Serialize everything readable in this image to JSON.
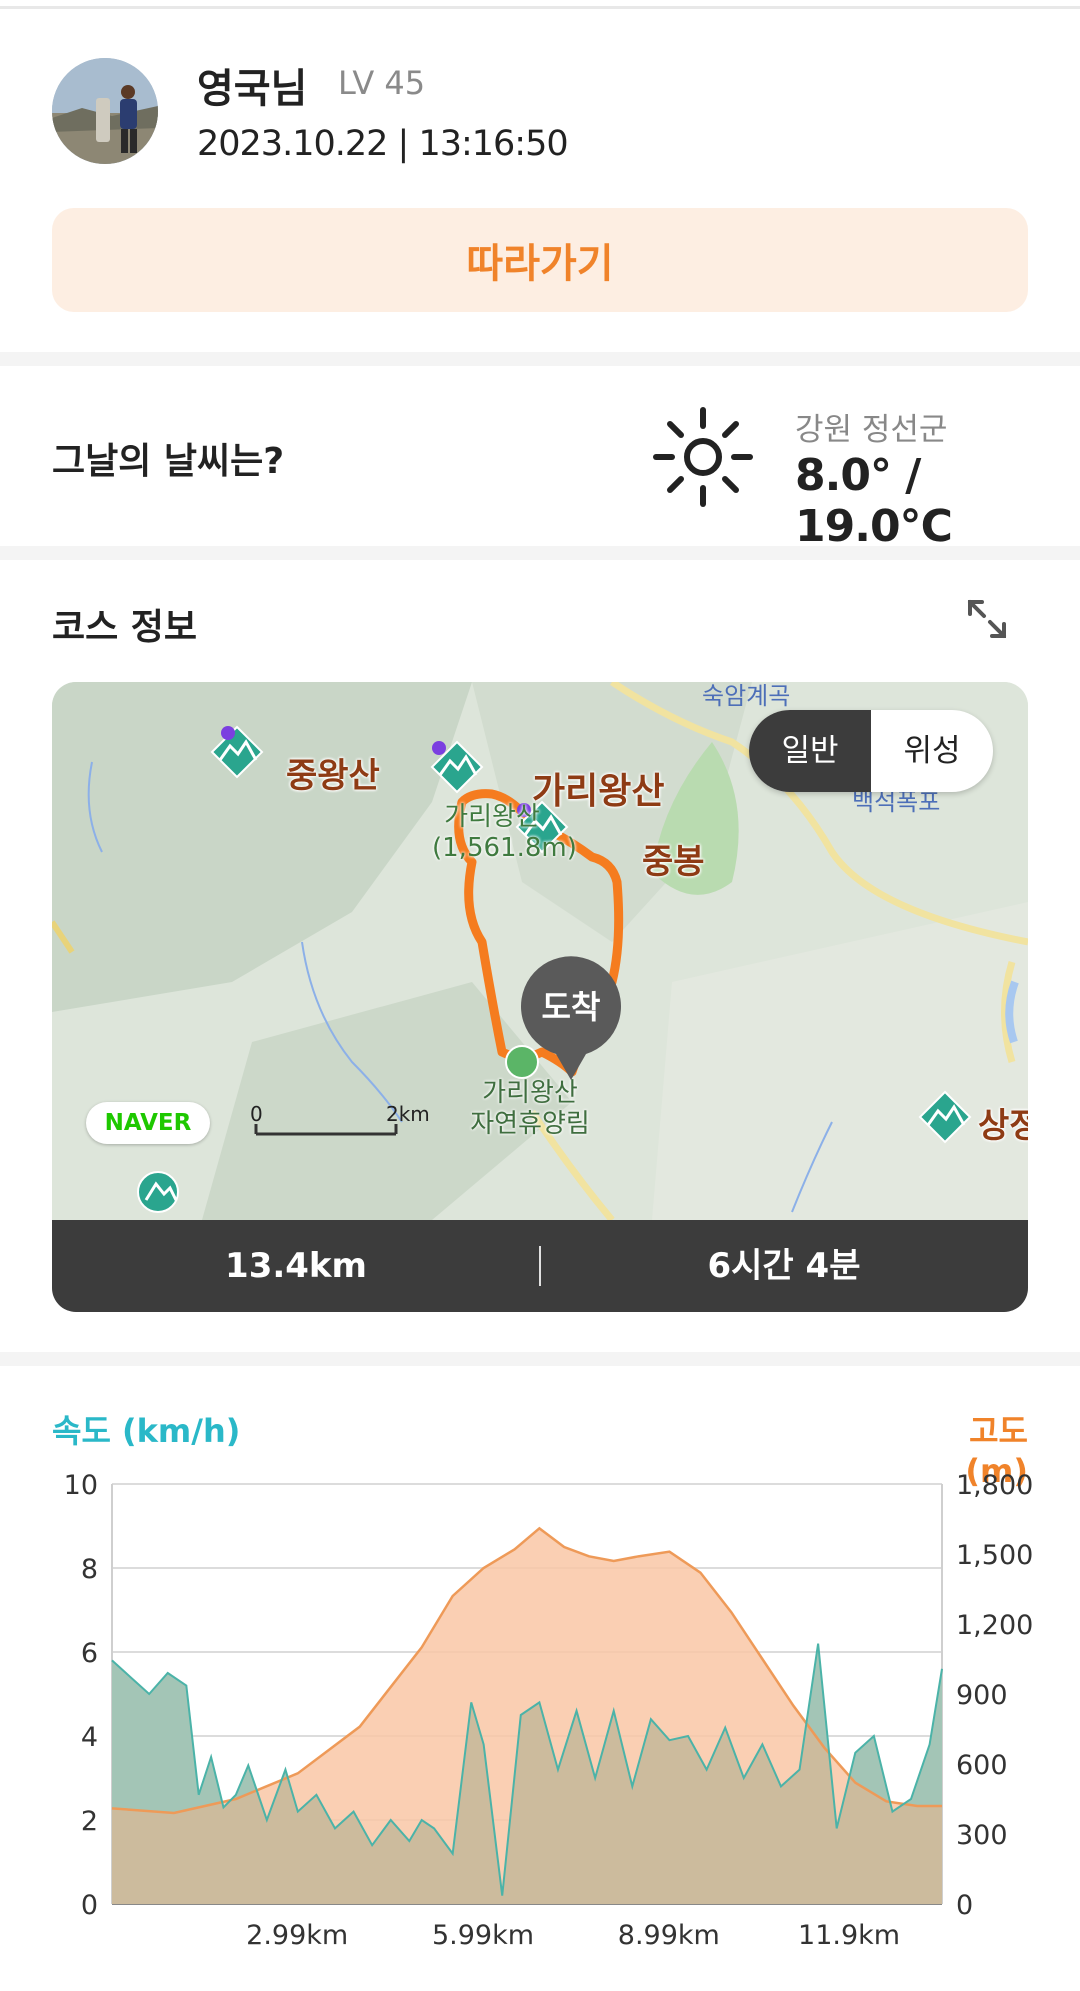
{
  "profile": {
    "name": "영국님",
    "level": "LV 45",
    "datetime": "2023.10.22 | 13:16:50",
    "follow_label": "따라가기"
  },
  "weather": {
    "question": "그날의 날씨는?",
    "icon": "sun-icon",
    "region": "강원 정선군",
    "temperature": "8.0° / 19.0℃"
  },
  "course": {
    "title": "코스 정보",
    "map": {
      "toggle": {
        "normal": "일반",
        "satellite": "위성"
      },
      "peaks": [
        "중왕산",
        "가리왕산",
        "중봉",
        "상정"
      ],
      "peak_sub_line1": "가리왕산",
      "peak_sub_line2": "(1,561.8m)",
      "forest_line1": "가리왕산",
      "forest_line2": "자연휴양림",
      "top_text": "숙암계곡",
      "falls_text": "백석폭포",
      "arrive_label": "도착",
      "naver_logo": "NAVER",
      "scale_zero": "0",
      "scale_km": "2km"
    },
    "distance": "13.4km",
    "duration": "6시간 4분"
  },
  "graph": {
    "speed_axis_label": "속도 (km/h)",
    "altitude_axis_label": "고도 (m)"
  },
  "colors": {
    "accent": "#f0832a",
    "speed": "#2ab8c8",
    "altitude_fill": "#f9c7a6"
  },
  "chart_data": {
    "type": "area",
    "x_ticks": [
      "2.99km",
      "5.99km",
      "8.99km",
      "11.9km"
    ],
    "x_tick_positions_km": [
      2.99,
      5.99,
      8.99,
      11.9
    ],
    "xlim_km": [
      0,
      13.4
    ],
    "speed_ticks": [
      "0",
      "2",
      "4",
      "6",
      "8",
      "10"
    ],
    "speed_ylim": [
      0,
      10
    ],
    "altitude_ticks": [
      "0",
      "300",
      "600",
      "900",
      "1,200",
      "1,500",
      "1,800"
    ],
    "altitude_ylim": [
      0,
      1800
    ],
    "series": [
      {
        "name": "고도 (m)",
        "x_km": [
          0,
          1.0,
          2.0,
          3.0,
          4.0,
          5.0,
          5.5,
          6.0,
          6.5,
          6.9,
          7.3,
          7.7,
          8.1,
          8.5,
          9.0,
          9.5,
          10.0,
          10.5,
          11.0,
          11.5,
          12.0,
          12.5,
          13.0,
          13.4
        ],
        "values": [
          410,
          390,
          450,
          560,
          760,
          1100,
          1320,
          1440,
          1520,
          1610,
          1530,
          1490,
          1470,
          1490,
          1510,
          1420,
          1250,
          1050,
          850,
          670,
          520,
          440,
          420,
          420
        ]
      },
      {
        "name": "속도 (km/h)",
        "x_km": [
          0,
          0.3,
          0.6,
          0.9,
          1.2,
          1.4,
          1.6,
          1.8,
          2.0,
          2.2,
          2.5,
          2.8,
          3.0,
          3.3,
          3.6,
          3.9,
          4.2,
          4.5,
          4.8,
          5.0,
          5.2,
          5.5,
          5.8,
          6.0,
          6.3,
          6.6,
          6.9,
          7.2,
          7.5,
          7.8,
          8.1,
          8.4,
          8.7,
          9.0,
          9.3,
          9.6,
          9.9,
          10.2,
          10.5,
          10.8,
          11.1,
          11.4,
          11.7,
          12.0,
          12.3,
          12.6,
          12.9,
          13.2,
          13.4
        ],
        "values": [
          5.8,
          5.4,
          5.0,
          5.5,
          5.2,
          2.6,
          3.5,
          2.3,
          2.6,
          3.3,
          2.0,
          3.2,
          2.2,
          2.6,
          1.8,
          2.2,
          1.4,
          2.0,
          1.5,
          2.0,
          1.8,
          1.2,
          4.8,
          3.8,
          0.2,
          4.5,
          4.8,
          3.2,
          4.6,
          3.0,
          4.6,
          2.8,
          4.4,
          3.9,
          4.0,
          3.2,
          4.2,
          3.0,
          3.8,
          2.8,
          3.2,
          6.2,
          1.8,
          3.6,
          4.0,
          2.2,
          2.5,
          3.8,
          5.6
        ]
      }
    ]
  }
}
